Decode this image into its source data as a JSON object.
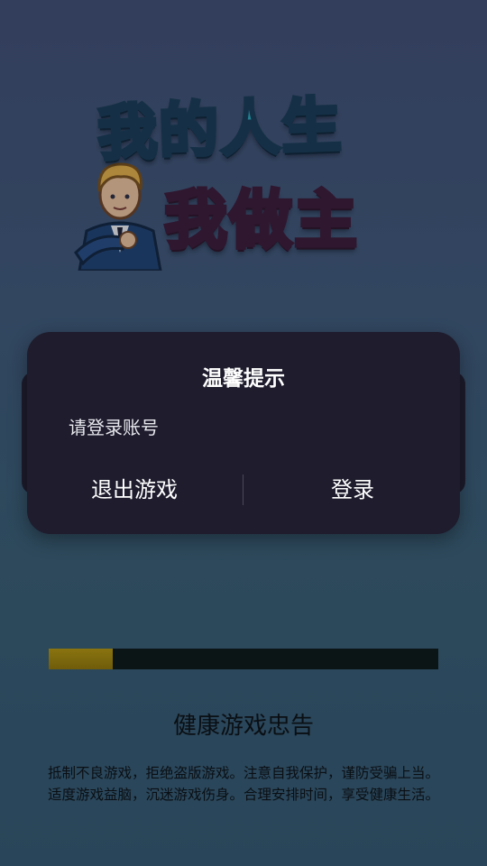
{
  "logo": {
    "line1": "我的人生",
    "line2_part1": "我",
    "line2_part2": "做",
    "line2_part3": "主"
  },
  "dialog": {
    "title": "温馨提示",
    "message": "请登录账号",
    "exit_label": "退出游戏",
    "login_label": "登录"
  },
  "loading": {
    "progress": 0.165
  },
  "health_notice": {
    "title": "健康游戏忠告",
    "line1": "抵制不良游戏，拒绝盗版游戏。注意自我保护，谨防受骗上当。",
    "line2": "适度游戏益脑，沉迷游戏伤身。合理安排时间，享受健康生活。"
  },
  "colors": {
    "background_top": "#3f4b6e",
    "background_bottom": "#31556a",
    "dialog_bg": "#1e1c2d",
    "progress_fill": "#7d690c",
    "progress_track": "#0b1516"
  }
}
